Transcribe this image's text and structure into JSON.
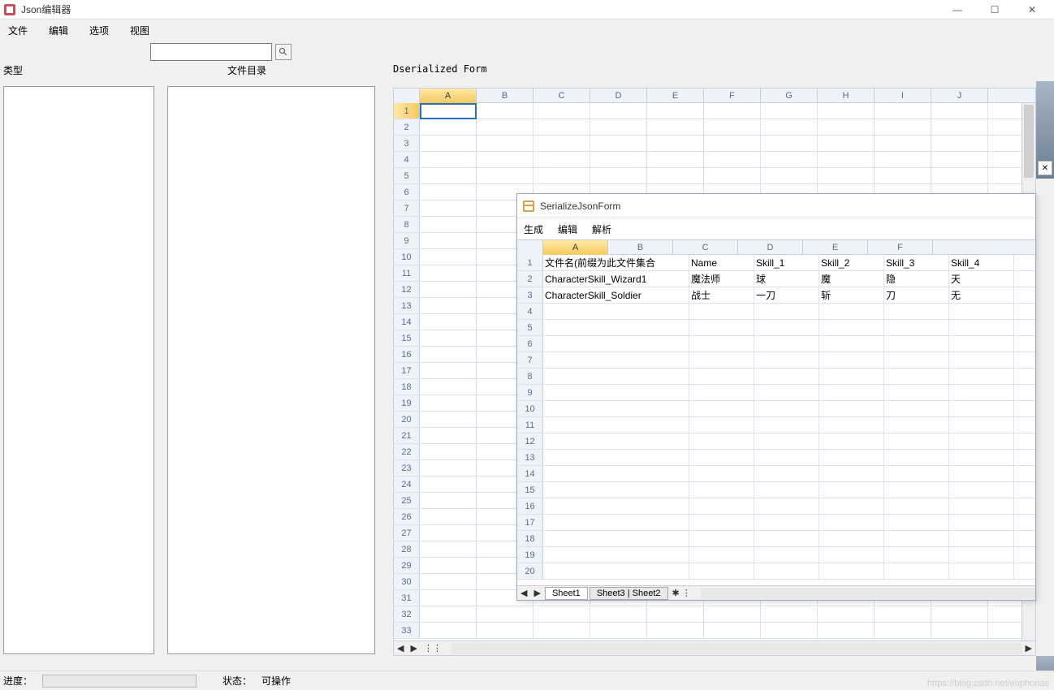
{
  "window": {
    "title": "Json编辑器",
    "minimize": "—",
    "maximize": "☐",
    "close": "✕"
  },
  "menu": {
    "file": "文件",
    "edit": "编辑",
    "options": "选项",
    "view": "视图"
  },
  "search": {
    "placeholder": "",
    "value": ""
  },
  "labels": {
    "type": "类型",
    "file_dir": "文件目录",
    "dser_form": "Dserialized Form"
  },
  "main_grid": {
    "columns": [
      "A",
      "B",
      "C",
      "D",
      "E",
      "F",
      "G",
      "H",
      "I",
      "J"
    ],
    "row_count": 33,
    "active_row": 1,
    "active_col": 0,
    "tabs_new": "⋮⋮"
  },
  "child_window": {
    "title": "SerializeJsonForm",
    "menu": {
      "generate": "生成",
      "edit": "编辑",
      "parse": "解析"
    },
    "columns": [
      "A",
      "B",
      "C",
      "D",
      "E",
      "F"
    ],
    "row_count": 20,
    "active_col": 0,
    "data": [
      [
        "文件名(前缀为此文件集合",
        "Name",
        "Skill_1",
        "Skill_2",
        "Skill_3",
        "Skill_4"
      ],
      [
        "CharacterSkill_Wizard1",
        "魔法师",
        "球",
        "魔",
        "隐",
        "天"
      ],
      [
        "CharacterSkill_Soldier",
        "战士",
        "一刀",
        "斩",
        "刀",
        "无"
      ]
    ],
    "tabs": [
      "Sheet1",
      "Sheet3 | Sheet2"
    ],
    "tab_new": "✱ ⋮"
  },
  "statusbar": {
    "progress_label": "进度：",
    "status_label": "状态：",
    "status_value": "可操作"
  },
  "side": {
    "close": "✕"
  },
  "watermark": "https://blog.csdn.net/euphorias"
}
